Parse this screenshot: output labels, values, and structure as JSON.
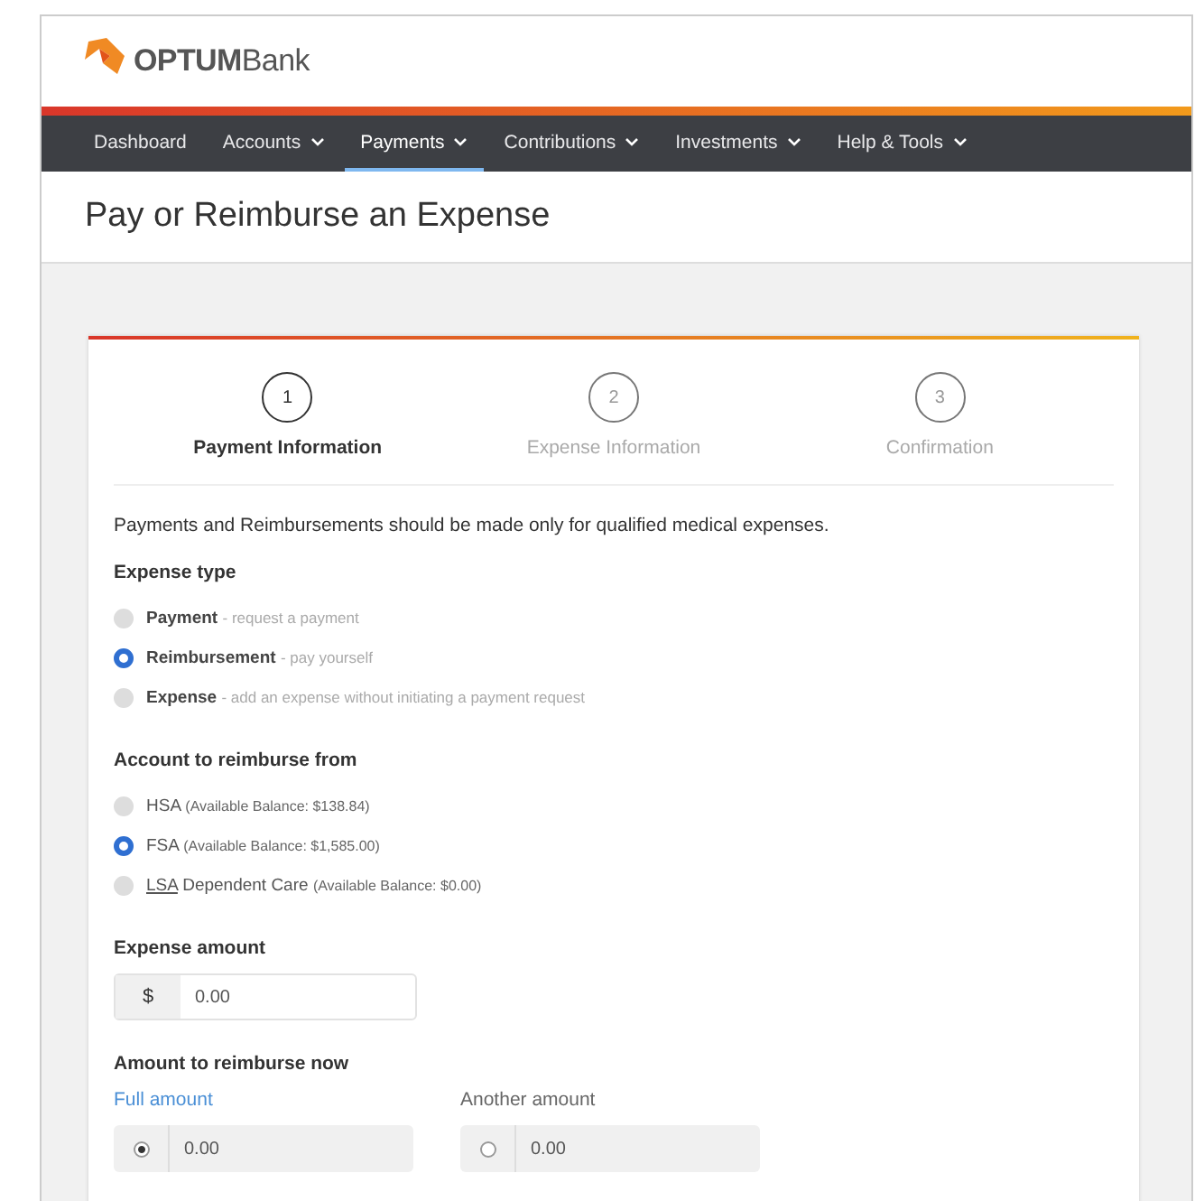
{
  "brand": {
    "name": "OPTUM",
    "suffix": "Bank"
  },
  "nav": [
    {
      "label": "Dashboard",
      "selected": false,
      "dropdown": false
    },
    {
      "label": "Accounts",
      "selected": false,
      "dropdown": true
    },
    {
      "label": "Payments",
      "selected": true,
      "dropdown": true
    },
    {
      "label": "Contributions",
      "selected": false,
      "dropdown": true
    },
    {
      "label": "Investments",
      "selected": false,
      "dropdown": true
    },
    {
      "label": "Help & Tools",
      "selected": false,
      "dropdown": true
    }
  ],
  "page_title": "Pay or Reimburse an Expense",
  "steps": [
    {
      "number": "1",
      "label": "Payment Information",
      "selected": true
    },
    {
      "number": "2",
      "label": "Expense Information",
      "selected": false
    },
    {
      "number": "3",
      "label": "Confirmation",
      "selected": false
    }
  ],
  "notice": "Payments and Reimbursements should be made only for qualified medical expenses.",
  "expense_type": {
    "label": "Expense type",
    "options": [
      {
        "label": "Payment",
        "hint": "- request a payment",
        "selected": false
      },
      {
        "label": "Reimbursement",
        "hint": "- pay yourself",
        "selected": true
      },
      {
        "label": "Expense",
        "hint": "- add an expense without initiating a payment request",
        "selected": false
      }
    ]
  },
  "account": {
    "label": "Account to reimburse from",
    "options": [
      {
        "abbr": "HSA",
        "underlined": false,
        "detail": "(Available Balance: $138.84)",
        "selected": false
      },
      {
        "abbr": "FSA",
        "underlined": false,
        "detail": "(Available Balance: $1,585.00)",
        "selected": true
      },
      {
        "abbr": "LSA",
        "underlined": true,
        "name": "Dependent Care",
        "detail": "(Available Balance: $0.00)",
        "selected": false
      }
    ]
  },
  "expense_amount": {
    "label": "Expense amount",
    "currency": "$",
    "value": "0.00"
  },
  "reimburse_now": {
    "label": "Amount to reimburse now",
    "options": [
      {
        "label": "Full amount",
        "value": "0.00",
        "selected": true
      },
      {
        "label": "Another amount",
        "value": "0.00",
        "selected": false
      }
    ]
  }
}
